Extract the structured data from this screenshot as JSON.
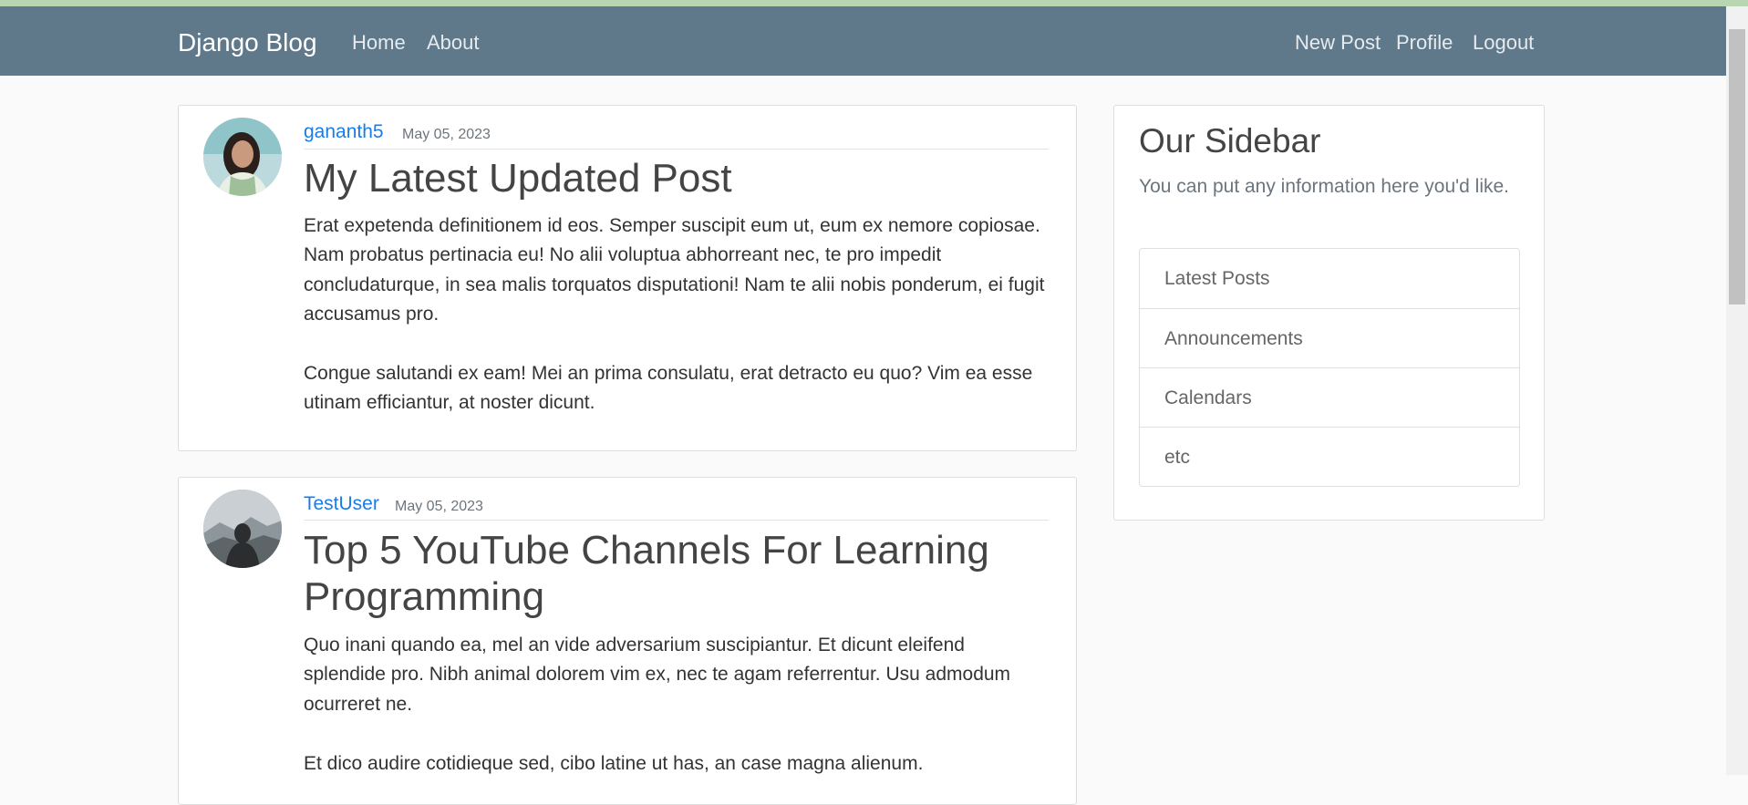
{
  "navbar": {
    "brand": "Django Blog",
    "left_links": [
      "Home",
      "About"
    ],
    "right_links": [
      "New Post",
      "Profile",
      "Logout"
    ]
  },
  "posts": [
    {
      "author": "gananth5",
      "date": "May 05, 2023",
      "title": "My Latest Updated Post",
      "paragraphs": [
        "Erat expetenda definitionem id eos. Semper suscipit eum ut, eum ex nemore copiosae. Nam probatus pertinacia eu! No alii voluptua abhorreant nec, te pro impedit concludaturque, in sea malis torquatos disputationi! Nam te alii nobis ponderum, ei fugit accusamus pro.",
        "Congue salutandi ex eam! Mei an prima consulatu, erat detracto eu quo? Vim ea esse utinam efficiantur, at noster dicunt."
      ]
    },
    {
      "author": "TestUser",
      "date": "May 05, 2023",
      "title": "Top 5 YouTube Channels For Learning Programming",
      "paragraphs": [
        "Quo inani quando ea, mel an vide adversarium suscipiantur. Et dicunt eleifend splendide pro. Nibh animal dolorem vim ex, nec te agam referrentur. Usu admodum ocurreret ne.",
        "Et dico audire cotidieque sed, cibo latine ut has, an case magna alienum."
      ]
    }
  ],
  "sidebar": {
    "title": "Our Sidebar",
    "description": "You can put any information here you'd like.",
    "items": [
      "Latest Posts",
      "Announcements",
      "Calendars",
      "etc"
    ]
  },
  "colors": {
    "navbar": "#5f788a",
    "author_link": "#1a7ce8",
    "page_background": "#fafafa"
  }
}
